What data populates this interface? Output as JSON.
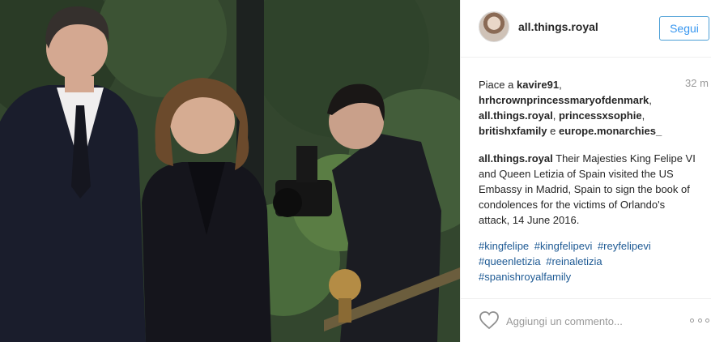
{
  "post": {
    "username": "all.things.royal",
    "follow_label": "Segui",
    "likes_prefix": "Piace a",
    "liked_by": [
      "kavire91",
      "hrhcrownprincessmaryofdenmark",
      "all.things.royal",
      "princessxsophie",
      "britishxfamily",
      "europe.monarchies_"
    ],
    "likes_conjunction": "e",
    "timestamp": "32 m",
    "caption_user": "all.things.royal",
    "caption_text": "Their Majesties King Felipe VI and Queen Letizia of Spain visited the US Embassy in Madrid, Spain to sign the book of condolences for the victims of Orlando's attack, 14 June 2016.",
    "hashtags": [
      "#kingfelipe",
      "#kingfelipevi",
      "#reyfelipevi",
      "#queenletizia",
      "#reinaletizia",
      "#spanishroyalfamily"
    ],
    "comment_placeholder": "Aggiungi un commento...",
    "icons": {
      "like": "heart-icon",
      "options": "more-options-icon"
    },
    "colors": {
      "accent": "#3897f0",
      "hashtag": "#1e5a94",
      "muted": "#999999"
    }
  }
}
